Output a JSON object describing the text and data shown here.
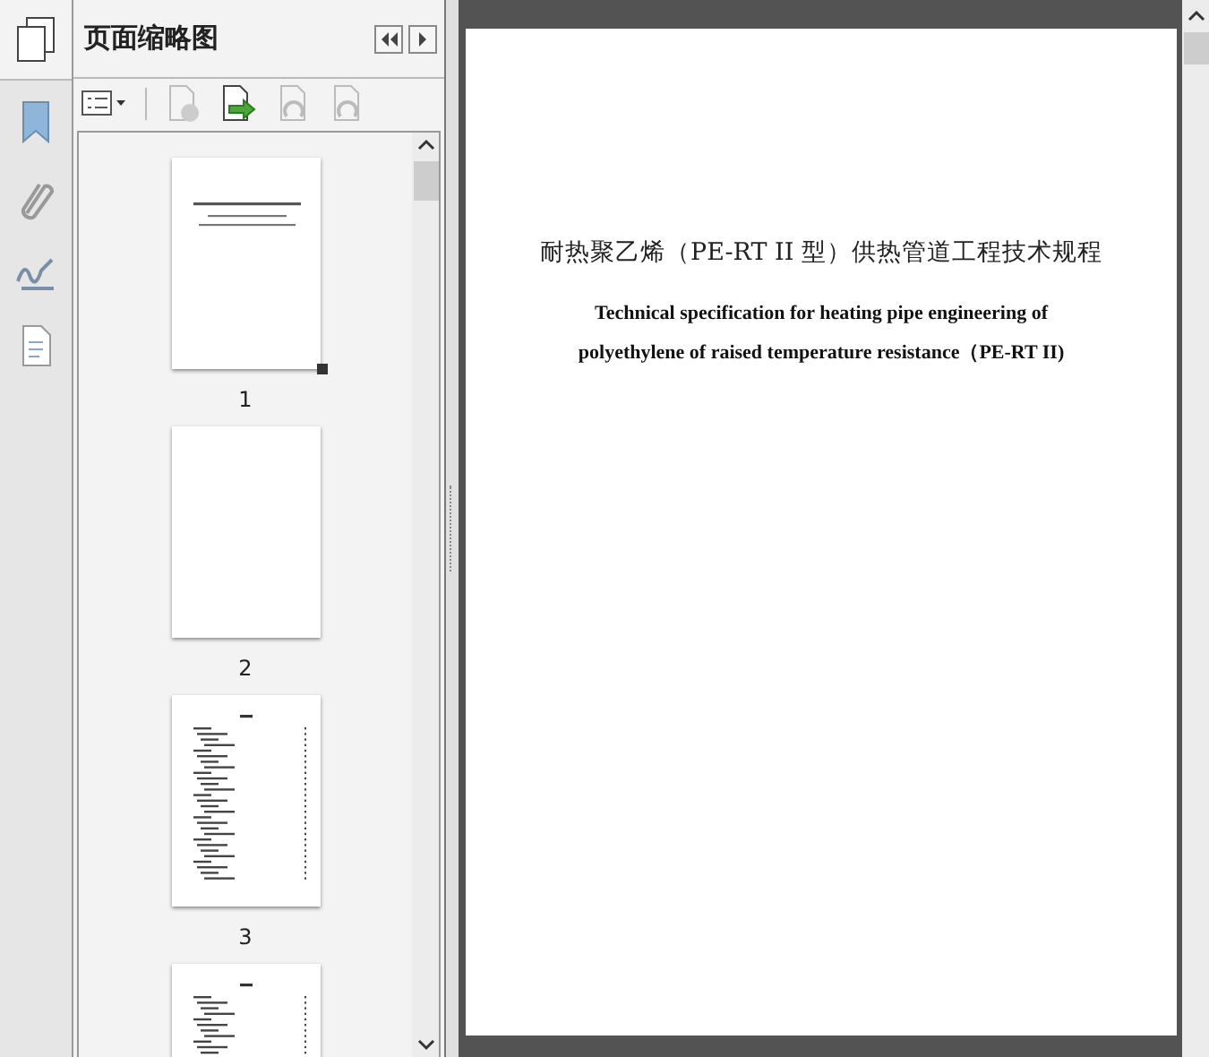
{
  "panel": {
    "title": "页面缩略图"
  },
  "thumbnails": [
    {
      "label": "1",
      "kind": "title",
      "selected": true
    },
    {
      "label": "2",
      "kind": "blank",
      "selected": false
    },
    {
      "label": "3",
      "kind": "toc",
      "selected": false
    },
    {
      "kind": "toc"
    }
  ],
  "document": {
    "title": "耐热聚乙烯（PE-RT II 型）供热管道工程技术规程",
    "subtitle_lines": [
      "Technical specification for heating pipe engineering of",
      "polyethylene of raised temperature resistance（PE-RT II)"
    ]
  }
}
